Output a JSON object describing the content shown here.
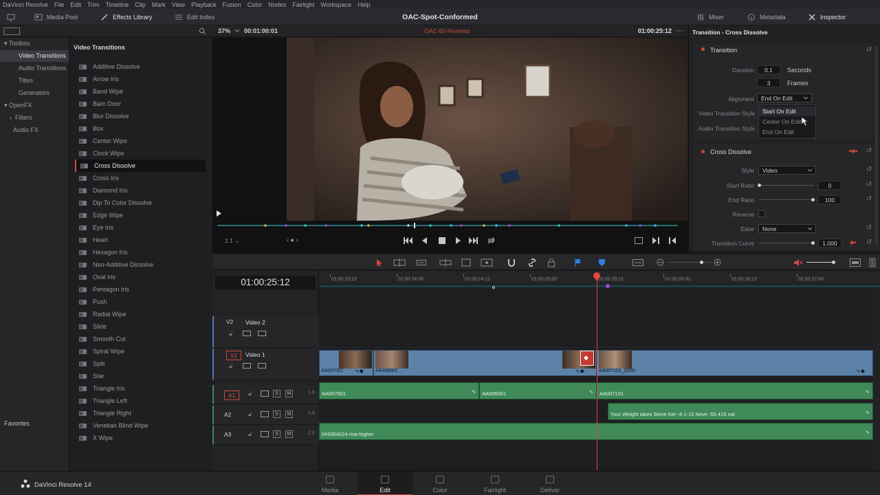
{
  "menu": [
    "DaVinci Resolve",
    "File",
    "Edit",
    "Trim",
    "Timeline",
    "Clip",
    "Mark",
    "View",
    "Playback",
    "Fusion",
    "Color",
    "Nodes",
    "Fairlight",
    "Workspace",
    "Help"
  ],
  "toolbar": {
    "media_pool": "Media Pool",
    "effects_library": "Effects Library",
    "edit_index": "Edit Index",
    "project_title": "OAC-Spot-Conformed",
    "mixer": "Mixer",
    "metadata": "Metadata",
    "inspector": "Inspector"
  },
  "viewer": {
    "zoom": "37%",
    "source_tc": "00:01:00:01",
    "timeline_name": "OAC-60-Finished",
    "record_tc": "01:00:25:12",
    "layout_label": "1:1"
  },
  "toolbox": {
    "items": [
      "Toolbox",
      "Video Transitions",
      "Audio Transitions",
      "Titles",
      "Generators",
      "OpenFX",
      "Filters",
      "Audio FX"
    ],
    "favorites": "Favorites"
  },
  "fxlist": {
    "header": "Video Transitions",
    "items": [
      "Additive Dissolve",
      "Arrow Iris",
      "Band Wipe",
      "Barn Door",
      "Blur Dissolve",
      "Box",
      "Center Wipe",
      "Clock Wipe",
      "Cross Dissolve",
      "Cross Iris",
      "Diamond Iris",
      "Dip To Color Dissolve",
      "Edge Wipe",
      "Eye Iris",
      "Heart",
      "Hexagon Iris",
      "Non-Additive Dissolve",
      "Oval Iris",
      "Pentagon Iris",
      "Push",
      "Radial Wipe",
      "Slide",
      "Smooth Cut",
      "Spiral Wipe",
      "Split",
      "Star",
      "Triangle Iris",
      "Triangle Left",
      "Triangle Right",
      "Venetian Blind Wipe",
      "X Wipe"
    ],
    "selected": "Cross Dissolve"
  },
  "inspector": {
    "title": "Transition - Cross Dissolve",
    "transition_section": "Transition",
    "duration_label": "Duration",
    "duration_seconds": "0.1",
    "seconds_unit": "Seconds",
    "duration_frames": "3",
    "frames_unit": "Frames",
    "alignment_label": "Alignment",
    "alignment_value": "End On Edit",
    "alignment_options": [
      "Start On Edit",
      "Center On Edit",
      "End On Edit"
    ],
    "vts_label": "Video Transition Style",
    "ats_label": "Audio Transition Style",
    "cross_section": "Cross Dissolve",
    "style_label": "Style",
    "style_value": "Video",
    "start_ratio_label": "Start Ratio",
    "start_ratio_value": "0",
    "end_ratio_label": "End Ratio",
    "end_ratio_value": "100",
    "reverse_label": "Reverse",
    "ease_label": "Ease",
    "ease_value": "None",
    "curve_label": "Transition Curve",
    "curve_value": "1.000"
  },
  "timeline": {
    "timecode": "01:00:25:12",
    "ruler": [
      "01:00:23:12",
      "01:00:24:00",
      "01:00:24:12",
      "01:00:25:00",
      "01:00:25:12",
      "01:00:26:00",
      "01:00:26:12",
      "01:00:27:00"
    ],
    "tracks": {
      "v2": {
        "id": "V2",
        "name": "Video 2"
      },
      "v1": {
        "id": "V1",
        "name": "Video 1"
      },
      "a1": {
        "id": "A1",
        "level": "1.0"
      },
      "a2": {
        "id": "A2",
        "level": "1.0"
      },
      "a3": {
        "id": "A3",
        "level": "2.0"
      }
    },
    "video_clips": [
      "AA007001",
      "AA006001",
      "AA007101_S000"
    ],
    "audio_a1": [
      "AA007001",
      "AA006001",
      "AA007101"
    ],
    "audio_a2": "Your Weight takes Steve Ket -4-1-15 Neve -55 416 nat",
    "audio_a3": "043304024-rise-higher",
    "track_buttons": {
      "solo": "S",
      "mute": "M"
    }
  },
  "pages": {
    "app_name": "DaVinci Resolve 14",
    "tabs": [
      "Media",
      "Edit",
      "Color",
      "Fairlight",
      "Deliver"
    ],
    "selected": "Edit"
  },
  "colors": {
    "accent": "#d24a3a",
    "video_clip": "#5c82a8",
    "audio_clip": "#3f8a58",
    "playhead": "#e0463a"
  }
}
